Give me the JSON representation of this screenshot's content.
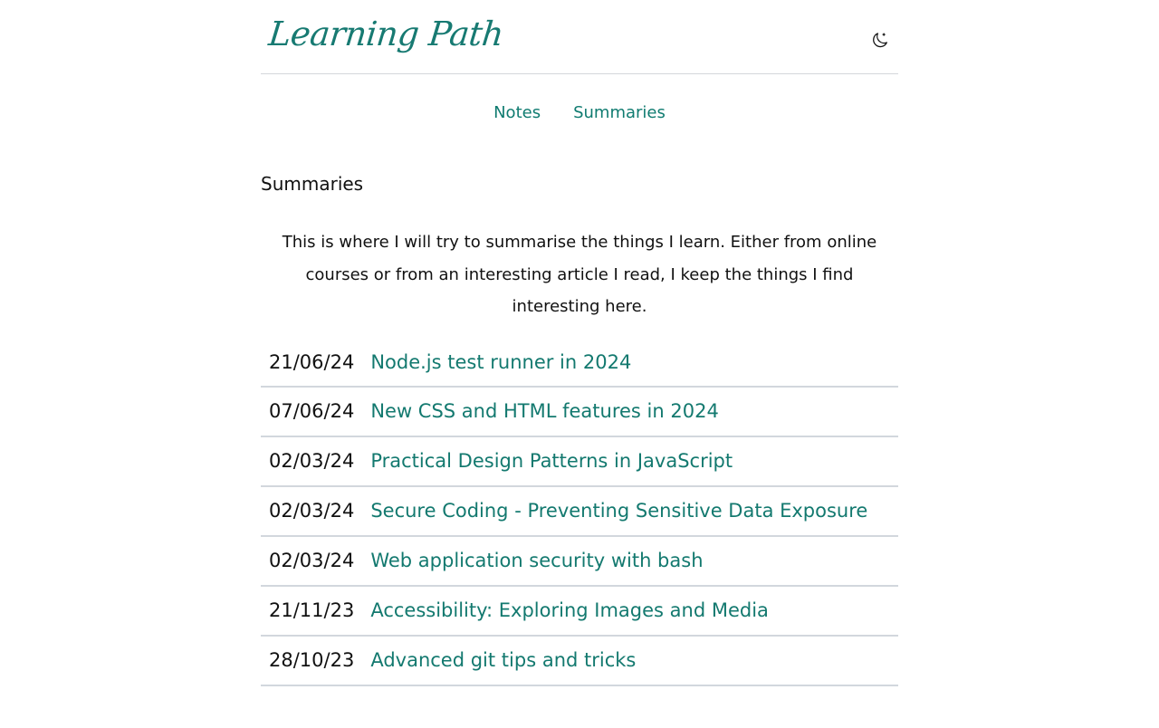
{
  "site": {
    "logo_text": "Learning Path"
  },
  "nav": {
    "items": [
      {
        "label": "Notes"
      },
      {
        "label": "Summaries"
      }
    ]
  },
  "page": {
    "title": "Summaries",
    "intro": "This is where I will try to summarise the things I learn. Either from online courses or from an interesting article I read, I keep the things I find interesting here."
  },
  "summaries": [
    {
      "date": "21/06/24",
      "title": "Node.js test runner in 2024"
    },
    {
      "date": "07/06/24",
      "title": "New CSS and HTML features in 2024"
    },
    {
      "date": "02/03/24",
      "title": "Practical Design Patterns in JavaScript"
    },
    {
      "date": "02/03/24",
      "title": "Secure Coding - Preventing Sensitive Data Exposure"
    },
    {
      "date": "02/03/24",
      "title": "Web application security with bash"
    },
    {
      "date": "21/11/23",
      "title": "Accessibility: Exploring Images and Media"
    },
    {
      "date": "28/10/23",
      "title": "Advanced git tips and tricks"
    }
  ],
  "icons": {
    "theme_toggle": "moon-icon"
  },
  "colors": {
    "accent": "#0f7b70",
    "text": "#111111",
    "divider": "#d2d7dd"
  }
}
